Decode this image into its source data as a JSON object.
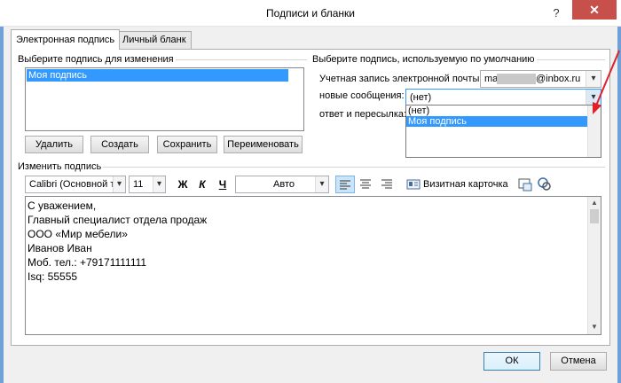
{
  "window": {
    "title": "Подписи и бланки",
    "help_label": "?",
    "close_label": "✕"
  },
  "tabs": [
    {
      "label": "Электронная подпись"
    },
    {
      "label": "Личный бланк"
    }
  ],
  "edit_select": {
    "group_label": "Выберите подпись для изменения",
    "items": [
      "Моя подпись"
    ],
    "buttons": {
      "delete": "Удалить",
      "create": "Создать",
      "save": "Сохранить",
      "rename": "Переименовать"
    }
  },
  "defaults": {
    "group_label": "Выберите подпись, используемую по умолчанию",
    "account_label": "Учетная запись электронной почты:",
    "account_value_prefix": "ma",
    "account_value_suffix": "@inbox.ru",
    "new_messages_label": "новые сообщения:",
    "new_messages_value": "(нет)",
    "reply_label": "ответ и пересылка:",
    "dropdown_options": [
      "(нет)",
      "Моя подпись"
    ],
    "dropdown_selected": "Моя подпись"
  },
  "editor": {
    "label": "Изменить подпись",
    "font_name": "Calibri (Основной те",
    "font_size": "11",
    "bold": "Ж",
    "italic": "К",
    "underline": "Ч",
    "color": "Авто",
    "business_card": "Визитная карточка",
    "lines": [
      "С уважением,",
      "Главный специалист отдела продаж",
      "ООО «Мир мебели»",
      "Иванов Иван",
      "Моб. тел.: +79171111111",
      "Isq: 55555"
    ]
  },
  "footer": {
    "ok": "ОК",
    "cancel": "Отмена"
  },
  "colors": {
    "accent": "#3399ff",
    "close": "#c7504b",
    "frame": "#6fa0d8",
    "annotation": "#e0202a"
  }
}
